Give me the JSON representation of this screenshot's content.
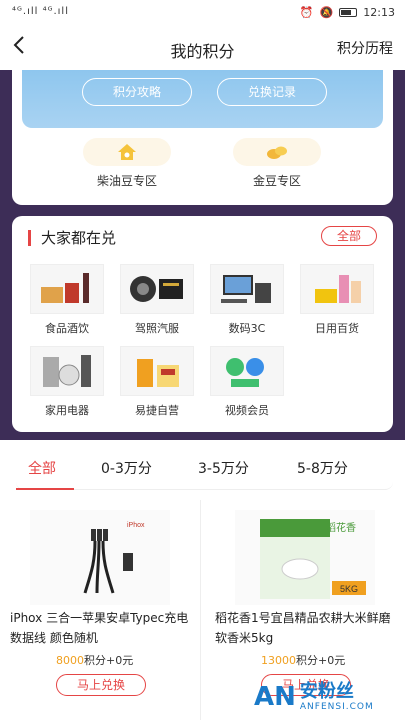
{
  "status_bar": {
    "signal": "⁴ᴳ.ıll ⁴ᴳ.ıll",
    "time": "12:13"
  },
  "nav": {
    "back_icon": "chevron-left-icon",
    "title": "我的积分",
    "history_label": "积分历程"
  },
  "banner": {
    "buttons": [
      "积分攻略",
      "兑换记录"
    ]
  },
  "zones": [
    {
      "label": "柴油豆专区",
      "icon": "home-bean-icon"
    },
    {
      "label": "金豆专区",
      "icon": "gold-bean-icon"
    }
  ],
  "section": {
    "title": "大家都在兑",
    "all_label": "全部",
    "categories": [
      {
        "label": "食品酒饮",
        "icon": "food-icon"
      },
      {
        "label": "驾照汽服",
        "icon": "car-icon"
      },
      {
        "label": "数码3C",
        "icon": "digital-icon"
      },
      {
        "label": "日用百货",
        "icon": "daily-goods-icon"
      },
      {
        "label": "家用电器",
        "icon": "appliance-icon"
      },
      {
        "label": "易捷自营",
        "icon": "store-icon"
      },
      {
        "label": "视频会员",
        "icon": "video-icon"
      }
    ]
  },
  "filter_tabs": [
    "全部",
    "0-3万分",
    "3-5万分",
    "5-8万分"
  ],
  "products": [
    {
      "name": "iPhox 三合一苹果安卓Typec充电数据线 颜色随机",
      "image_label": "iPhox",
      "points": "8000",
      "price_suffix": "积分+0元",
      "button": "马上兑换"
    },
    {
      "name": "稻花香1号宜昌精品农耕大米鲜磨软香米5kg",
      "image_label": "稻花香",
      "points": "13000",
      "price_suffix": "积分+0元",
      "button": "马上兑换"
    }
  ],
  "watermark": {
    "logo": "AN",
    "cn": "安粉丝",
    "en": "ANFENSI.COM"
  },
  "colors": {
    "accent": "#e54545",
    "purple_bg": "#3d2d57",
    "banner_blue": "#8ec6ee",
    "points_orange": "#f0a020"
  }
}
